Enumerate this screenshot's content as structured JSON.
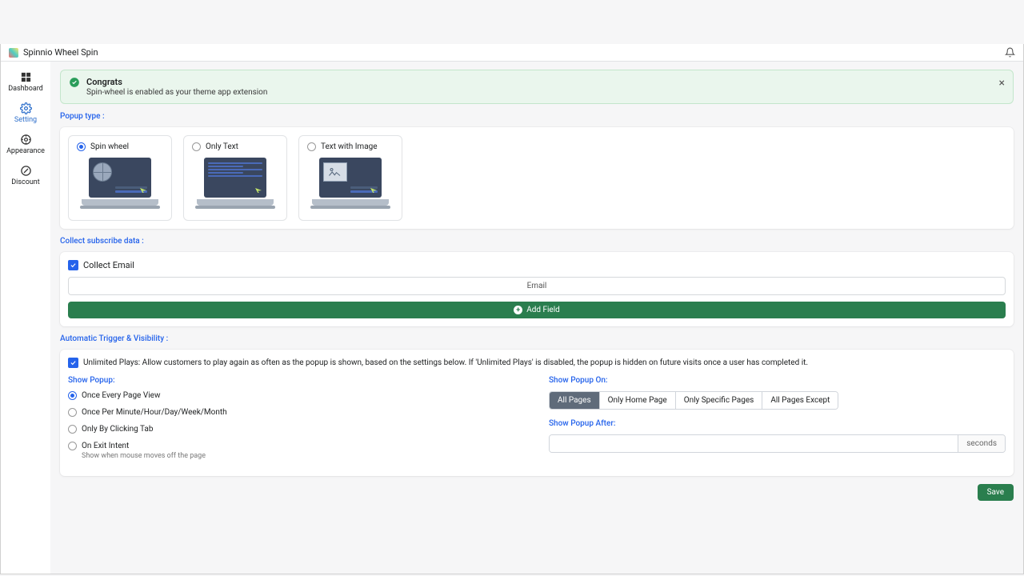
{
  "topbar": {
    "title": "Spinnio Wheel Spin"
  },
  "sidebar": {
    "items": [
      {
        "label": "Dashboard"
      },
      {
        "label": "Setting"
      },
      {
        "label": "Appearance"
      },
      {
        "label": "Discount"
      }
    ]
  },
  "banner": {
    "title": "Congrats",
    "desc": "Spin-wheel is enabled as your theme app extension"
  },
  "sections": {
    "popup_type": "Popup type :",
    "collect_data": "Collect subscribe data :",
    "trigger": "Automatic Trigger & Visibility :"
  },
  "popup_types": [
    {
      "label": "Spin wheel"
    },
    {
      "label": "Only Text"
    },
    {
      "label": "Text with Image"
    }
  ],
  "collect": {
    "collect_email_label": "Collect Email",
    "email_field": "Email",
    "add_field": "Add Field"
  },
  "trigger": {
    "unlimited_desc": "Unlimited Plays: Allow customers to play again as often as the popup is shown, based on the settings below. If 'Unlimited Plays' is disabled, the popup is hidden on future visits once a user has completed it.",
    "show_popup": "Show Popup:",
    "options": [
      {
        "label": "Once Every Page View"
      },
      {
        "label": "Once Per Minute/Hour/Day/Week/Month"
      },
      {
        "label": "Only By Clicking Tab"
      },
      {
        "label": "On Exit Intent",
        "desc": "Show when mouse moves off the page"
      }
    ],
    "show_on": "Show Popup On:",
    "segments": [
      "All Pages",
      "Only Home Page",
      "Only Specific Pages",
      "All Pages Except"
    ],
    "show_after": "Show Popup After:",
    "seconds_suffix": "seconds"
  },
  "buttons": {
    "save": "Save"
  }
}
